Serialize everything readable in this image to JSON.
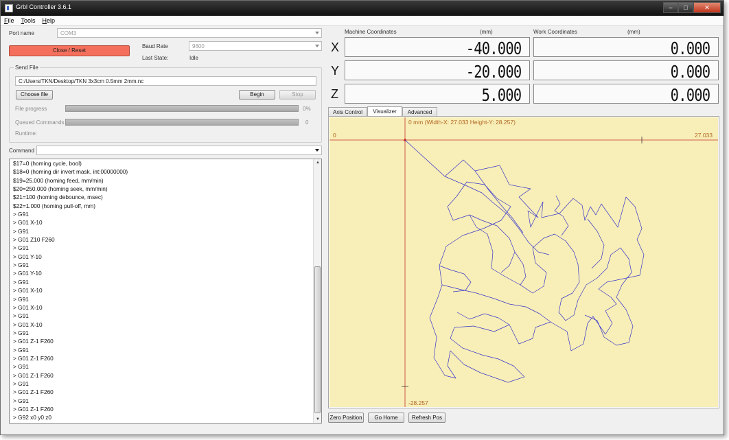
{
  "window": {
    "title": "Grbl Controller 3.6.1",
    "controls": [
      "–",
      "□",
      "✕"
    ]
  },
  "menu": [
    "File",
    "Tools",
    "Help"
  ],
  "connection": {
    "port_label": "Port name",
    "port_value": "COM3",
    "close_reset_label": "Close / Reset",
    "baud_label": "Baud Rate",
    "baud_value": "9600",
    "state_label": "Last State:",
    "state_value": "Idle"
  },
  "send_file": {
    "group_title": "Send File",
    "path": "C:/Users/TKN/Desktop/TKN 3x3cm 0.5mm 2mm.nc",
    "choose_label": "Choose file",
    "begin_label": "Begin",
    "stop_label": "Stop",
    "file_progress_label": "File progress",
    "file_progress_value": "0%",
    "file_progress_fraction": 0,
    "queued_label": "Queued Commands",
    "queued_value": "0",
    "runtime_label": "Runtime:"
  },
  "command": {
    "label": "Command",
    "value": ""
  },
  "console": {
    "lines": [
      "$17=0 (homing cycle, bool)",
      "$18=0 (homing dir invert mask, int:00000000)",
      "$19=25.000 (homing feed, mm/min)",
      "$20=250.000 (homing seek, mm/min)",
      "$21=100 (homing debounce, msec)",
      "$22=1.000 (homing pull-off, mm)",
      "> G91",
      "> G01 X-10",
      "> G91",
      "> G01 Z10 F260",
      "> G91",
      "> G01 Y-10",
      "> G91",
      "> G01 Y-10",
      "> G91",
      "> G01 X-10",
      "> G91",
      "> G01 X-10",
      "> G91",
      "> G01 X-10",
      "> G91",
      "> G01 Z-1 F260",
      "> G91",
      "> G01 Z-1 F260",
      "> G91",
      "> G01 Z-1 F260",
      "> G91",
      "> G01 Z-1 F260",
      "> G91",
      "> G01 Z-1 F260",
      "> G92 x0 y0 z0"
    ]
  },
  "coordinates": {
    "machine_label": "Machine Coordinates",
    "machine_unit": "(mm)",
    "work_label": "Work Coordinates",
    "work_unit": "(mm)",
    "axes": [
      {
        "axis": "X",
        "machine": "-40.000",
        "work": "0.000"
      },
      {
        "axis": "Y",
        "machine": "-20.000",
        "work": "0.000"
      },
      {
        "axis": "Z",
        "machine": "5.000",
        "work": "0.000"
      }
    ]
  },
  "tabs": [
    {
      "label": "Axis Control",
      "active": false
    },
    {
      "label": "Visualizer",
      "active": true
    },
    {
      "label": "Advanced",
      "active": false
    }
  ],
  "visualizer": {
    "header": "0 mm  (Width-X: 27.033  Height-Y: 28.257)",
    "x_min_label": "0",
    "x_max_label": "27.033",
    "y_min_label": "-28.257",
    "bg_color": "#f8eeb7",
    "path_color": "#3030d0",
    "axis_color": "#c03030"
  },
  "bottom_buttons": {
    "zero": "Zero Position",
    "home": "Go Home",
    "refresh": "Refresh Pos"
  }
}
